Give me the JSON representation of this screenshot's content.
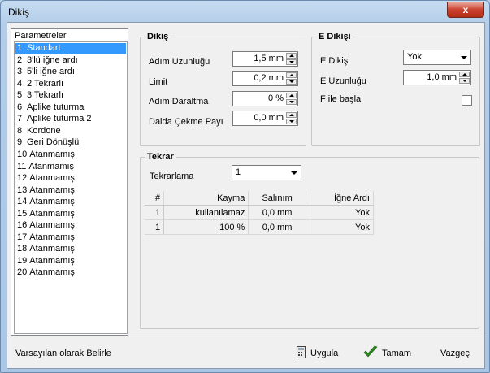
{
  "window": {
    "title": "Dikiş",
    "close_glyph": "x"
  },
  "params": {
    "legend": "Parametreler",
    "items": [
      {
        "num": "1",
        "label": "Standart",
        "selected": true
      },
      {
        "num": "2",
        "label": "3'lü iğne ardı"
      },
      {
        "num": "3",
        "label": "5'li iğne ardı"
      },
      {
        "num": "4",
        "label": "2 Tekrarlı"
      },
      {
        "num": "5",
        "label": "3 Tekrarlı"
      },
      {
        "num": "6",
        "label": "Aplike tuturma"
      },
      {
        "num": "7",
        "label": "Aplike tuturma 2"
      },
      {
        "num": "8",
        "label": "Kordone"
      },
      {
        "num": "9",
        "label": "Geri Dönüşlü"
      },
      {
        "num": "10",
        "label": "Atanmamış"
      },
      {
        "num": "11",
        "label": "Atanmamış"
      },
      {
        "num": "12",
        "label": "Atanmamış"
      },
      {
        "num": "13",
        "label": "Atanmamış"
      },
      {
        "num": "14",
        "label": "Atanmamış"
      },
      {
        "num": "15",
        "label": "Atanmamış"
      },
      {
        "num": "16",
        "label": "Atanmamış"
      },
      {
        "num": "17",
        "label": "Atanmamış"
      },
      {
        "num": "18",
        "label": "Atanmamış"
      },
      {
        "num": "19",
        "label": "Atanmamış"
      },
      {
        "num": "20",
        "label": "Atanmamış"
      }
    ]
  },
  "dikis": {
    "legend": "Dikiş",
    "adim_uzunlugu": {
      "label": "Adım Uzunluğu",
      "value": "1,5 mm"
    },
    "limit": {
      "label": "Limit",
      "value": "0,2 mm"
    },
    "adim_daraltma": {
      "label": "Adım Daraltma",
      "value": "0 %"
    },
    "dalda_cekme": {
      "label": "Dalda Çekme Payı",
      "value": "0,0 mm"
    }
  },
  "edikisi": {
    "legend": "E Dikişi",
    "dikis": {
      "label": "E Dikişi",
      "value": "Yok"
    },
    "uzunluk": {
      "label": "E Uzunluğu",
      "value": "1,0 mm"
    },
    "fileb": {
      "label": "F ile başla"
    }
  },
  "tekrar": {
    "legend": "Tekrar",
    "tekrarlama": {
      "label": "Tekrarlama",
      "value": "1"
    },
    "headers": {
      "num": "#",
      "kayma": "Kayma",
      "salinim": "Salınım",
      "igne": "İğne Ardı"
    },
    "rows": [
      {
        "num": "1",
        "kayma": "kullanılamaz",
        "salinim": "0,0 mm",
        "igne": "Yok"
      },
      {
        "num": "1",
        "kayma": "100 %",
        "salinim": "0,0 mm",
        "igne": "Yok"
      }
    ]
  },
  "buttons": {
    "default": "Varsayılan olarak Belirle",
    "apply": "Uygula",
    "ok": "Tamam",
    "cancel": "Vazgeç"
  },
  "colors": {
    "selection": "#3399ff",
    "ok_check": "#2a8a1e"
  }
}
